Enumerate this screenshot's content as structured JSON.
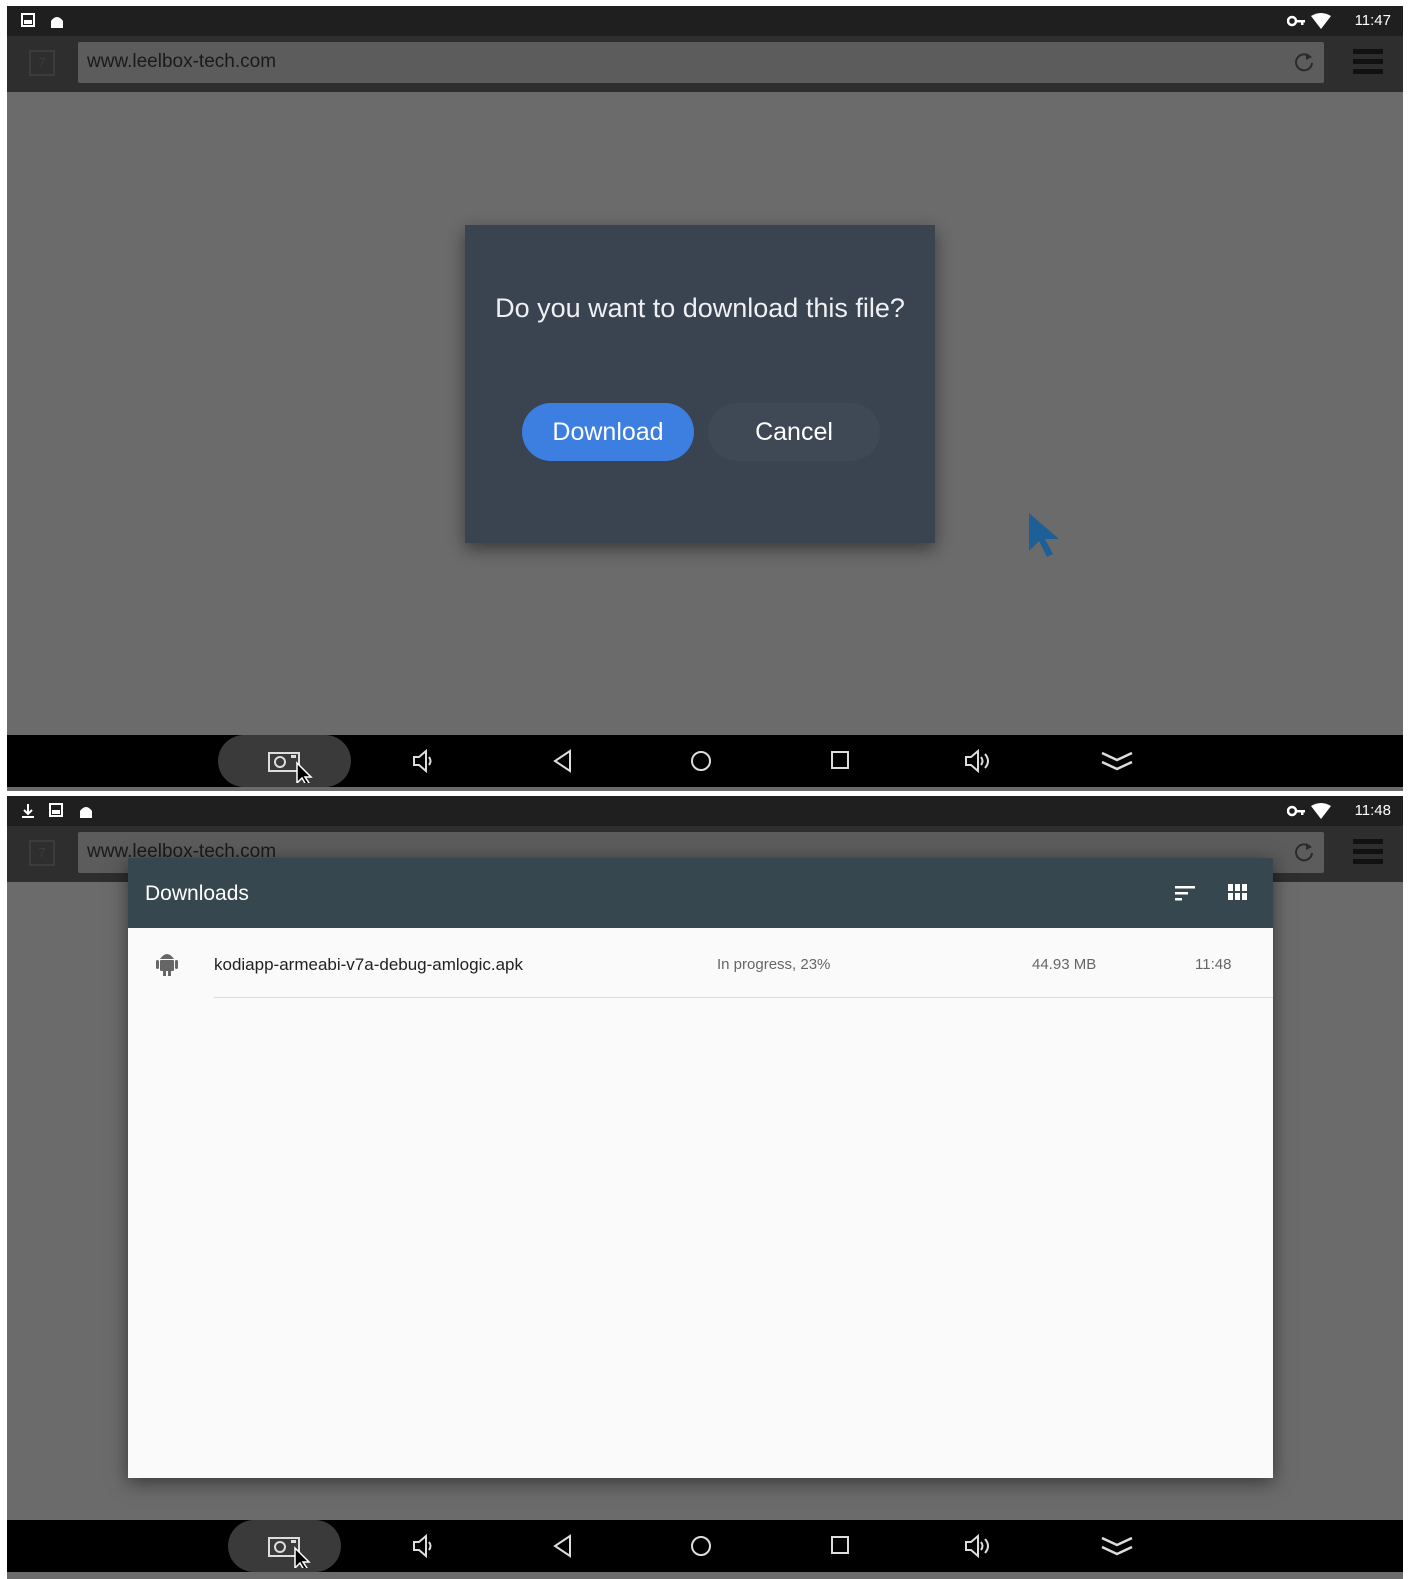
{
  "screen1": {
    "status_time": "11:47",
    "tab_count": "7",
    "url": "www.leelbox-tech.com",
    "dialog": {
      "message": "Do you want to download this file?",
      "download_label": "Download",
      "cancel_label": "Cancel"
    }
  },
  "screen2": {
    "status_time": "11:48",
    "tab_count": "7",
    "url": "www.leelbox-tech.com",
    "downloads": {
      "title": "Downloads",
      "items": [
        {
          "name": "kodiapp-armeabi-v7a-debug-amlogic.apk",
          "status": "In progress, 23%",
          "size": "44.93 MB",
          "time": "11:48"
        }
      ]
    }
  },
  "icons": {
    "status_left": [
      "image-icon",
      "android-icon"
    ],
    "status_left_2": [
      "download-icon",
      "image-icon",
      "android-icon"
    ],
    "status_right": [
      "vpn-key-icon",
      "wifi-icon"
    ],
    "navbar": [
      "screenshot-icon",
      "volume-down-icon",
      "back-icon",
      "home-icon",
      "recents-icon",
      "volume-up-icon",
      "collapse-icon"
    ]
  },
  "colors": {
    "download_button": "#3d7fe0",
    "dialog_bg": "#3a4350",
    "downloads_header": "#37474f",
    "page_bg": "#6b6b6b"
  }
}
